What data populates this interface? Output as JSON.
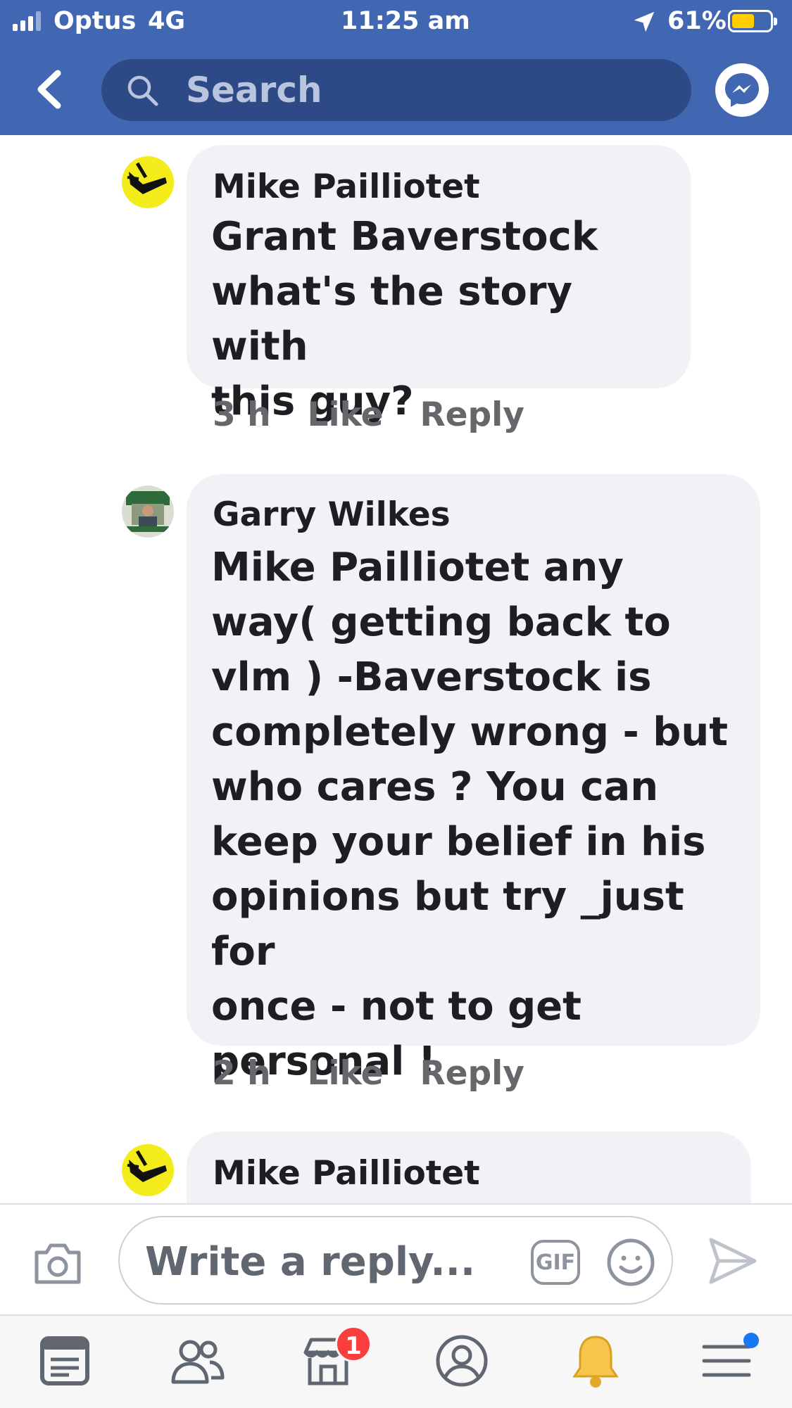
{
  "status_bar": {
    "carrier": "Optus",
    "network": "4G",
    "time": "11:25 am",
    "battery_pct": "61%",
    "battery_level": 0.61
  },
  "header": {
    "back_icon": "chevron-left-icon",
    "search_placeholder": "Search",
    "messenger_icon": "messenger-icon",
    "colors": {
      "brand": "#4267b2",
      "search_bg": "#2d4a86"
    }
  },
  "comments": [
    {
      "author": "Mike Pailliotet",
      "mention": "Grant Baverstock",
      "line2": "what's the story with",
      "line3": "this guy?",
      "time": "3 h",
      "like": "Like",
      "reply": "Reply"
    },
    {
      "author": "Garry Wilkes",
      "mention": "Mike Pailliotet",
      "line1_rest": " any",
      "lines": [
        "way( getting back to",
        "vlm ) -Baverstock is",
        "completely wrong - but",
        "who cares ? You can",
        "keep your belief in his",
        "opinions but try _just for",
        "once - not to get",
        "personal !"
      ],
      "time": "2 h",
      "like": "Like",
      "reply": "Reply"
    },
    {
      "author": "Mike Pailliotet"
    }
  ],
  "composer": {
    "placeholder": "Write a reply...",
    "gif_label": "GIF"
  },
  "tabbar": {
    "marketplace_badge": "1",
    "items": [
      "news-feed-icon",
      "friends-icon",
      "marketplace-icon",
      "profile-icon",
      "notifications-bell-icon",
      "menu-icon"
    ]
  }
}
